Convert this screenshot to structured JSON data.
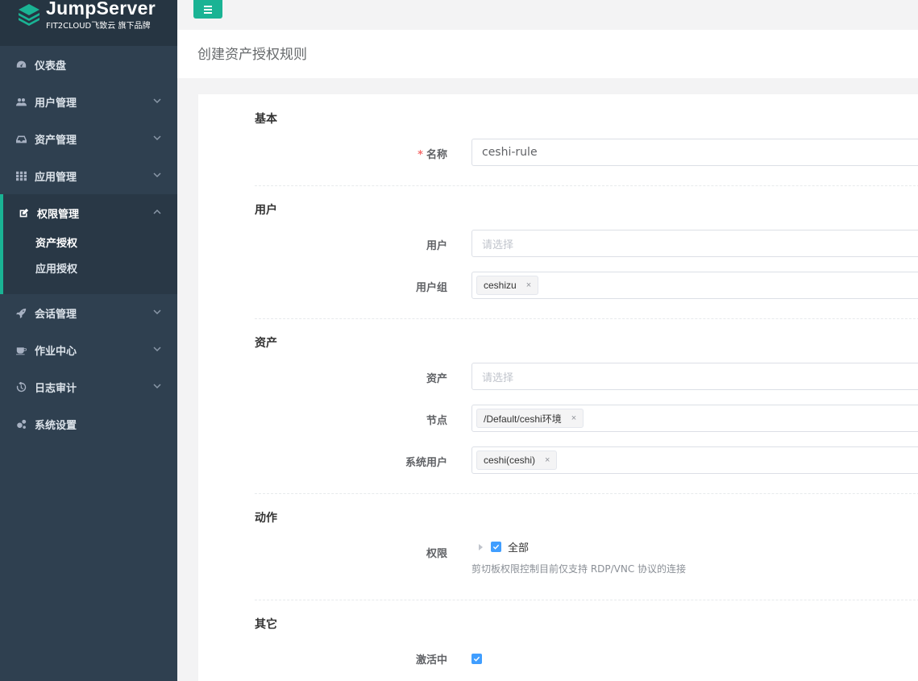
{
  "brand": {
    "name": "JumpServer",
    "tagline": "FIT2CLOUD飞致云 旗下品牌"
  },
  "colors": {
    "sidebar": "#2f4050",
    "accent": "#1ab394",
    "checkbox": "#409eff"
  },
  "sidebar": {
    "items": [
      {
        "label": "仪表盘",
        "icon": "dashboard-icon",
        "expandable": false
      },
      {
        "label": "用户管理",
        "icon": "users-icon",
        "expandable": true
      },
      {
        "label": "资产管理",
        "icon": "inbox-icon",
        "expandable": true
      },
      {
        "label": "应用管理",
        "icon": "grid-icon",
        "expandable": true
      },
      {
        "label": "权限管理",
        "icon": "edit-icon",
        "expandable": true,
        "active": true,
        "children": [
          {
            "label": "资产授权",
            "current": true
          },
          {
            "label": "应用授权"
          }
        ]
      },
      {
        "label": "会话管理",
        "icon": "rocket-icon",
        "expandable": true
      },
      {
        "label": "作业中心",
        "icon": "coffee-icon",
        "expandable": true
      },
      {
        "label": "日志审计",
        "icon": "history-icon",
        "expandable": true
      },
      {
        "label": "系统设置",
        "icon": "gears-icon",
        "expandable": false
      }
    ]
  },
  "page": {
    "title": "创建资产授权规则"
  },
  "form": {
    "sections": {
      "basic": "基本",
      "user": "用户",
      "asset": "资产",
      "action": "动作",
      "other": "其它"
    },
    "name": {
      "label": "名称",
      "required_mark": "*",
      "value": "ceshi-rule"
    },
    "users": {
      "label": "用户",
      "placeholder": "请选择"
    },
    "user_groups": {
      "label": "用户组",
      "tags": [
        "ceshizu"
      ]
    },
    "assets": {
      "label": "资产",
      "placeholder": "请选择"
    },
    "nodes": {
      "label": "节点",
      "tags": [
        "/Default/ceshi环境"
      ]
    },
    "system_users": {
      "label": "系统用户",
      "tags": [
        "ceshi(ceshi)"
      ]
    },
    "permissions": {
      "label": "权限",
      "option": "全部",
      "checked": true,
      "help": "剪切板权限控制目前仅支持 RDP/VNC 协议的连接"
    },
    "is_active": {
      "label": "激活中",
      "checked": true
    },
    "tag_close": "×"
  }
}
